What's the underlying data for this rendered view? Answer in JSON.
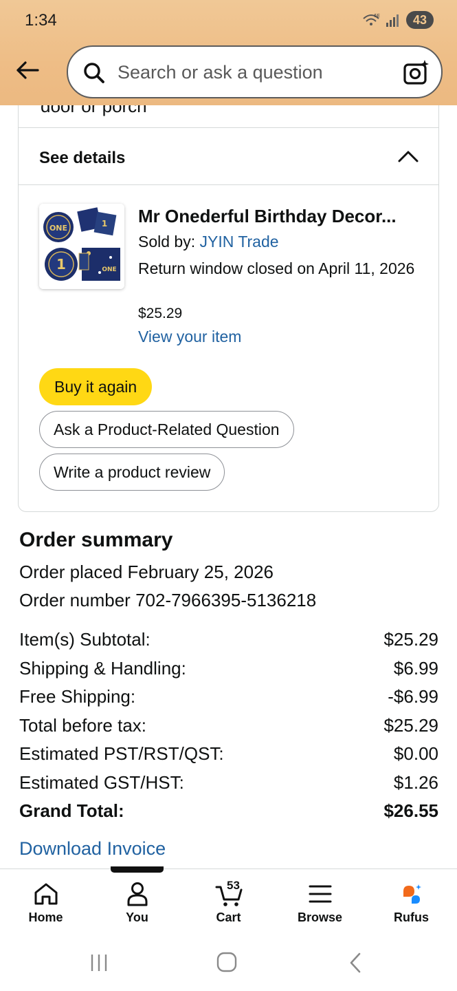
{
  "status_bar": {
    "time": "1:34",
    "network_label": "6E",
    "battery": "43"
  },
  "search": {
    "placeholder": "Search or ask a question"
  },
  "delivery_card": {
    "partial_text": "door or porch",
    "see_details_label": "See details"
  },
  "product": {
    "title": "Mr Onederful Birthday Decor...",
    "sold_by_prefix": "Sold by: ",
    "seller": "JYIN Trade",
    "return_window": "Return window closed on April 11, 2026",
    "price": "$25.29",
    "view_item_label": "View your item",
    "image_text": "ONE"
  },
  "actions": {
    "buy_again": "Buy it again",
    "ask_question": "Ask a Product-Related Question",
    "write_review": "Write a product review"
  },
  "order_summary": {
    "title": "Order summary",
    "placed": "Order placed February 25, 2026",
    "number": "Order number 702-7966395-5136218",
    "rows": [
      {
        "label": "Item(s) Subtotal:",
        "value": "$25.29"
      },
      {
        "label": "Shipping & Handling:",
        "value": "$6.99"
      },
      {
        "label": "Free Shipping:",
        "value": "-$6.99"
      },
      {
        "label": "Total before tax:",
        "value": "$25.29"
      },
      {
        "label": "Estimated PST/RST/QST:",
        "value": "$0.00"
      },
      {
        "label": "Estimated GST/HST:",
        "value": "$1.26"
      },
      {
        "label": "Grand Total:",
        "value": "$26.55"
      }
    ],
    "download_invoice": "Download Invoice"
  },
  "bottom_nav": {
    "home": "Home",
    "you": "You",
    "cart": "Cart",
    "cart_count": "53",
    "browse": "Browse",
    "rufus": "Rufus"
  },
  "colors": {
    "header_bg": "#eebd86",
    "link": "#2162a1",
    "buy_again": "#ffd814",
    "rufus_orange": "#f26a1b",
    "rufus_blue": "#1a8cff"
  },
  "icons": [
    "back-arrow-icon",
    "search-icon",
    "camera-search-icon",
    "chevron-up-icon",
    "home-icon",
    "person-icon",
    "cart-icon",
    "menu-icon",
    "rufus-icon",
    "recents-icon",
    "home-circle-icon",
    "back-chevron-icon"
  ]
}
